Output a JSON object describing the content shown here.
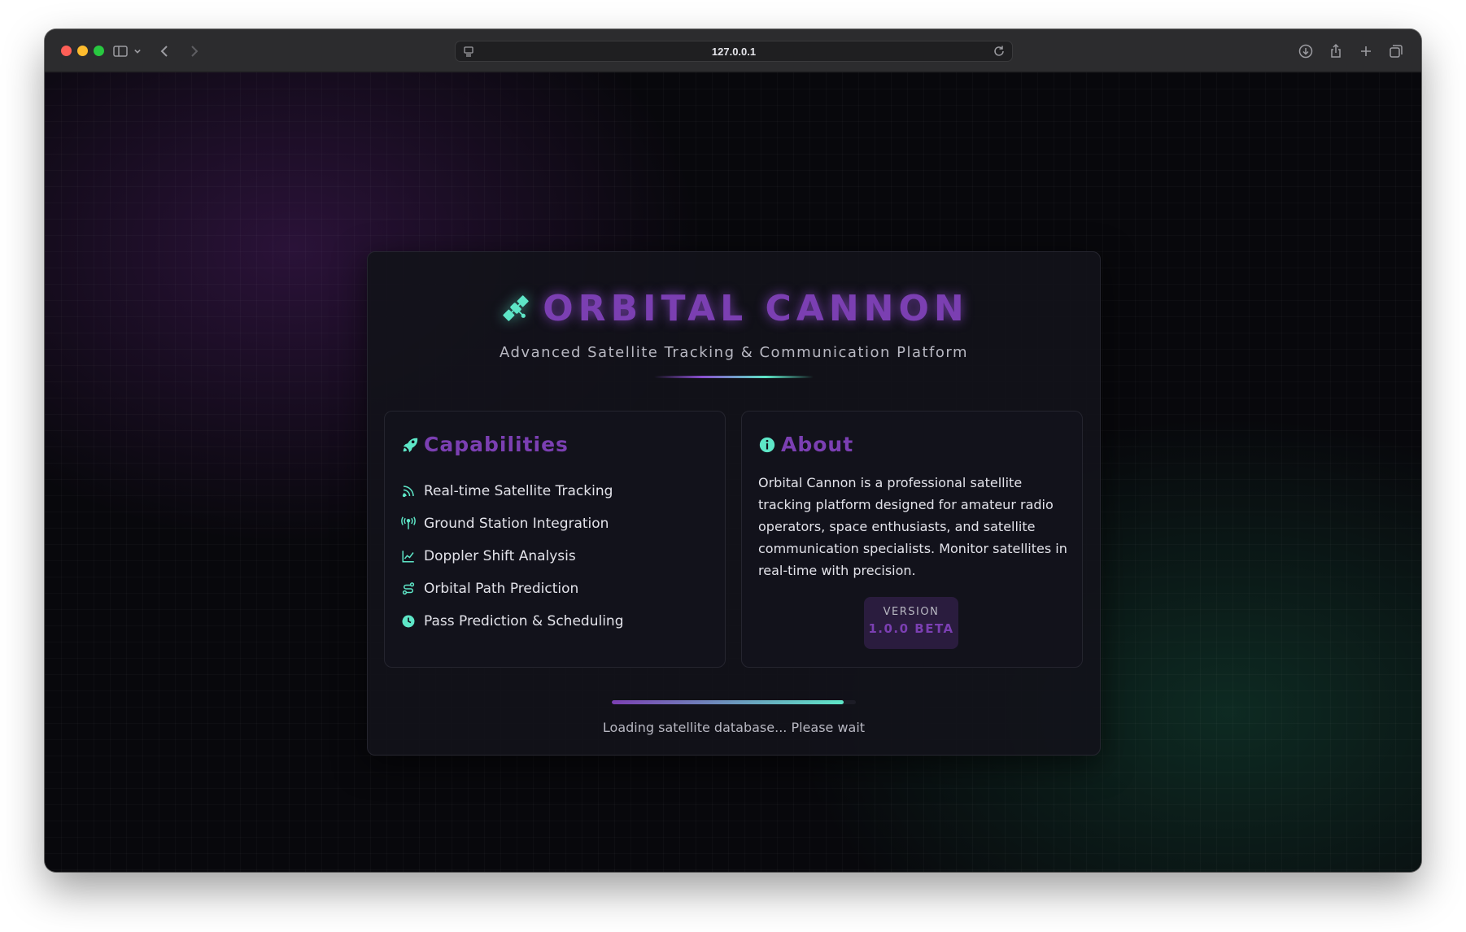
{
  "browser": {
    "url": "127.0.0.1",
    "icons": [
      "sidebar-icon",
      "chevron-down-icon",
      "back-icon",
      "forward-icon",
      "page-settings-icon",
      "reload-icon",
      "download-icon",
      "share-icon",
      "new-tab-icon",
      "tabs-overview-icon"
    ]
  },
  "app": {
    "title": "ORBITAL CANNON",
    "subtitle": "Advanced Satellite Tracking & Communication Platform",
    "logo_icon": "satellite-icon",
    "accent_purple": "#7b3fb2",
    "accent_teal": "#5ee6c7"
  },
  "capabilities": {
    "title": "Capabilities",
    "icon": "rocket-icon",
    "items": [
      {
        "label": "Real-time Satellite Tracking",
        "icon": "satellite-dish-icon"
      },
      {
        "label": "Ground Station Integration",
        "icon": "antenna-icon"
      },
      {
        "label": "Doppler Shift Analysis",
        "icon": "line-chart-icon"
      },
      {
        "label": "Orbital Path Prediction",
        "icon": "route-icon"
      },
      {
        "label": "Pass Prediction & Scheduling",
        "icon": "clock-icon"
      }
    ]
  },
  "about": {
    "title": "About",
    "icon": "info-icon",
    "description": "Orbital Cannon is a professional satellite tracking platform designed for amateur radio operators, space enthusiasts, and satellite communication specialists. Monitor satellites in real-time with precision.",
    "version_label": "VERSION",
    "version_value": "1.0.0 BETA"
  },
  "loading": {
    "progress": 0.95,
    "text": "Loading satellite database... Please wait"
  }
}
